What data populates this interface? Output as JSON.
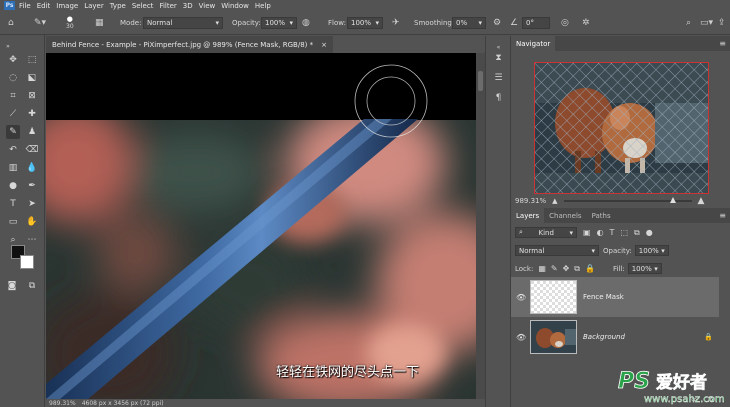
{
  "menubar": {
    "logo": "Ps",
    "items": [
      "File",
      "Edit",
      "Image",
      "Layer",
      "Type",
      "Select",
      "Filter",
      "3D",
      "View",
      "Window",
      "Help"
    ]
  },
  "options": {
    "brush_size": "30",
    "mode_label": "Mode:",
    "mode_value": "Normal",
    "opacity_label": "Opacity:",
    "opacity_value": "100%",
    "flow_label": "Flow:",
    "flow_value": "100%",
    "smoothing_label": "Smoothing:",
    "smoothing_value": "0%",
    "angle_value": "0°"
  },
  "document": {
    "tab_title": "Behind Fence - Example - PiXimperfect.jpg @ 989% (Fence Mask, RGB/8) *",
    "status_zoom": "989.31%",
    "status_info": "4608 px x 3456 px (72 ppi)",
    "subtitle": "轻轻在铁网的尽头点一下"
  },
  "navigator": {
    "title": "Navigator",
    "zoom": "989.31%"
  },
  "layers_panel": {
    "tabs": [
      "Layers",
      "Channels",
      "Paths"
    ],
    "kind_label": "Kind",
    "blend_mode": "Normal",
    "opacity_label": "Opacity:",
    "opacity_value": "100%",
    "lock_label": "Lock:",
    "fill_label": "Fill:",
    "fill_value": "100%",
    "layers": [
      {
        "name": "Fence Mask"
      },
      {
        "name": "Background"
      }
    ]
  },
  "watermark": {
    "brand": "PS",
    "chinese": "爱好者",
    "url": "www.psahz.com"
  },
  "colors": {
    "ui_bg": "#535353",
    "panel_header": "#474747",
    "accent_blue": "#2f6fb5",
    "selection_red": "#cc3333",
    "watermark_green": "#2aa24a"
  }
}
